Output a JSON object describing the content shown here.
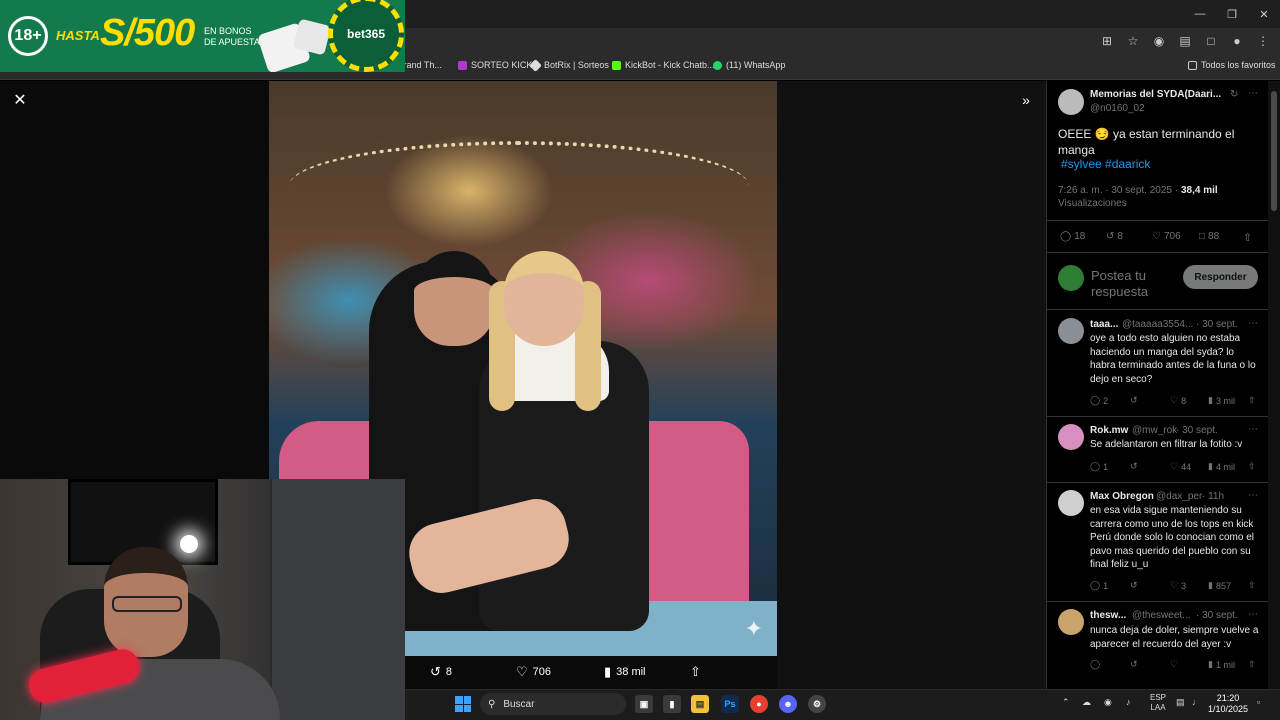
{
  "ad": {
    "age_badge": "18+",
    "hasta": "HASTA",
    "amount": "S/500",
    "bonus_text": "EN BONOS DE APUESTA",
    "brand": "bet365"
  },
  "bookmarks": [
    {
      "label": "se de Grand Th...",
      "color": "#555555"
    },
    {
      "label": "SORTEO KICK",
      "color": "#b03ad1"
    },
    {
      "label": "BotRix | Sorteos",
      "color": "#dddddd"
    },
    {
      "label": "KickBot - Kick Chatb...",
      "color": "#53fc18"
    },
    {
      "label": "(11) WhatsApp",
      "color": "#25d366"
    },
    {
      "label": "Todos los favoritos",
      "color": "#cccccc"
    }
  ],
  "photo_actions": {
    "retweets": "8",
    "likes": "706",
    "views": "38 mil"
  },
  "tweet": {
    "author_name": "Memorias del SYDA(Daari...",
    "author_handle": "@n0160_02",
    "text": "OEEE 😏 ya estan terminando el manga",
    "hashtags": "#sylvee #daarick",
    "time": "7:26 a. m. · 30 sept. 2025 ·",
    "views_count": "38,4 mil",
    "views_label": "Visualizaciones",
    "replies": "18",
    "retweets": "8",
    "likes": "706",
    "bookmarks": "88"
  },
  "reply_box": {
    "placeholder": "Postea tu respuesta",
    "button": "Responder"
  },
  "replies": [
    {
      "name": "taaa...",
      "handle": "@taaaaa3554...",
      "date": "· 30 sept.",
      "text": "oye a todo esto alguien no estaba haciendo un manga del syda? lo habra terminado antes de la funa o lo dejo en seco?",
      "replies": "2",
      "retweets": "",
      "likes": "8",
      "views": "3 mil",
      "avatar": "#8a8f96"
    },
    {
      "name": "Rok.mw",
      "handle": "@mw_rok",
      "date": "· 30 sept.",
      "text": "Se adelantaron en filtrar la fotito :v",
      "replies": "1",
      "retweets": "",
      "likes": "44",
      "views": "4 mil",
      "avatar": "#d58fc0"
    },
    {
      "name": "Max Obregon",
      "handle": "@dax_per",
      "date": "· 11h",
      "text": "en esa vida sigue manteniendo su carrera como uno de los tops en kick Perú donde solo lo conocian como el pavo mas querido del pueblo con su final feliz  u_u",
      "replies": "1",
      "retweets": "",
      "likes": "3",
      "views": "857",
      "avatar": "#cfcfcf"
    },
    {
      "name": "thesw...",
      "handle": "@thesweet...",
      "date": "· 30 sept.",
      "text": "nunca deja de doler, siempre vuelve a aparecer el recuerdo del ayer :v",
      "replies": "",
      "retweets": "",
      "likes": "",
      "views": "1 mil",
      "avatar": "#c9a36b"
    }
  ],
  "taskbar": {
    "search": "Buscar",
    "lang1": "ESP",
    "lang2": "LAA",
    "time": "21:20",
    "date": "1/10/2025"
  },
  "icons": {
    "close": "close-icon",
    "expand": "expand-icon"
  }
}
